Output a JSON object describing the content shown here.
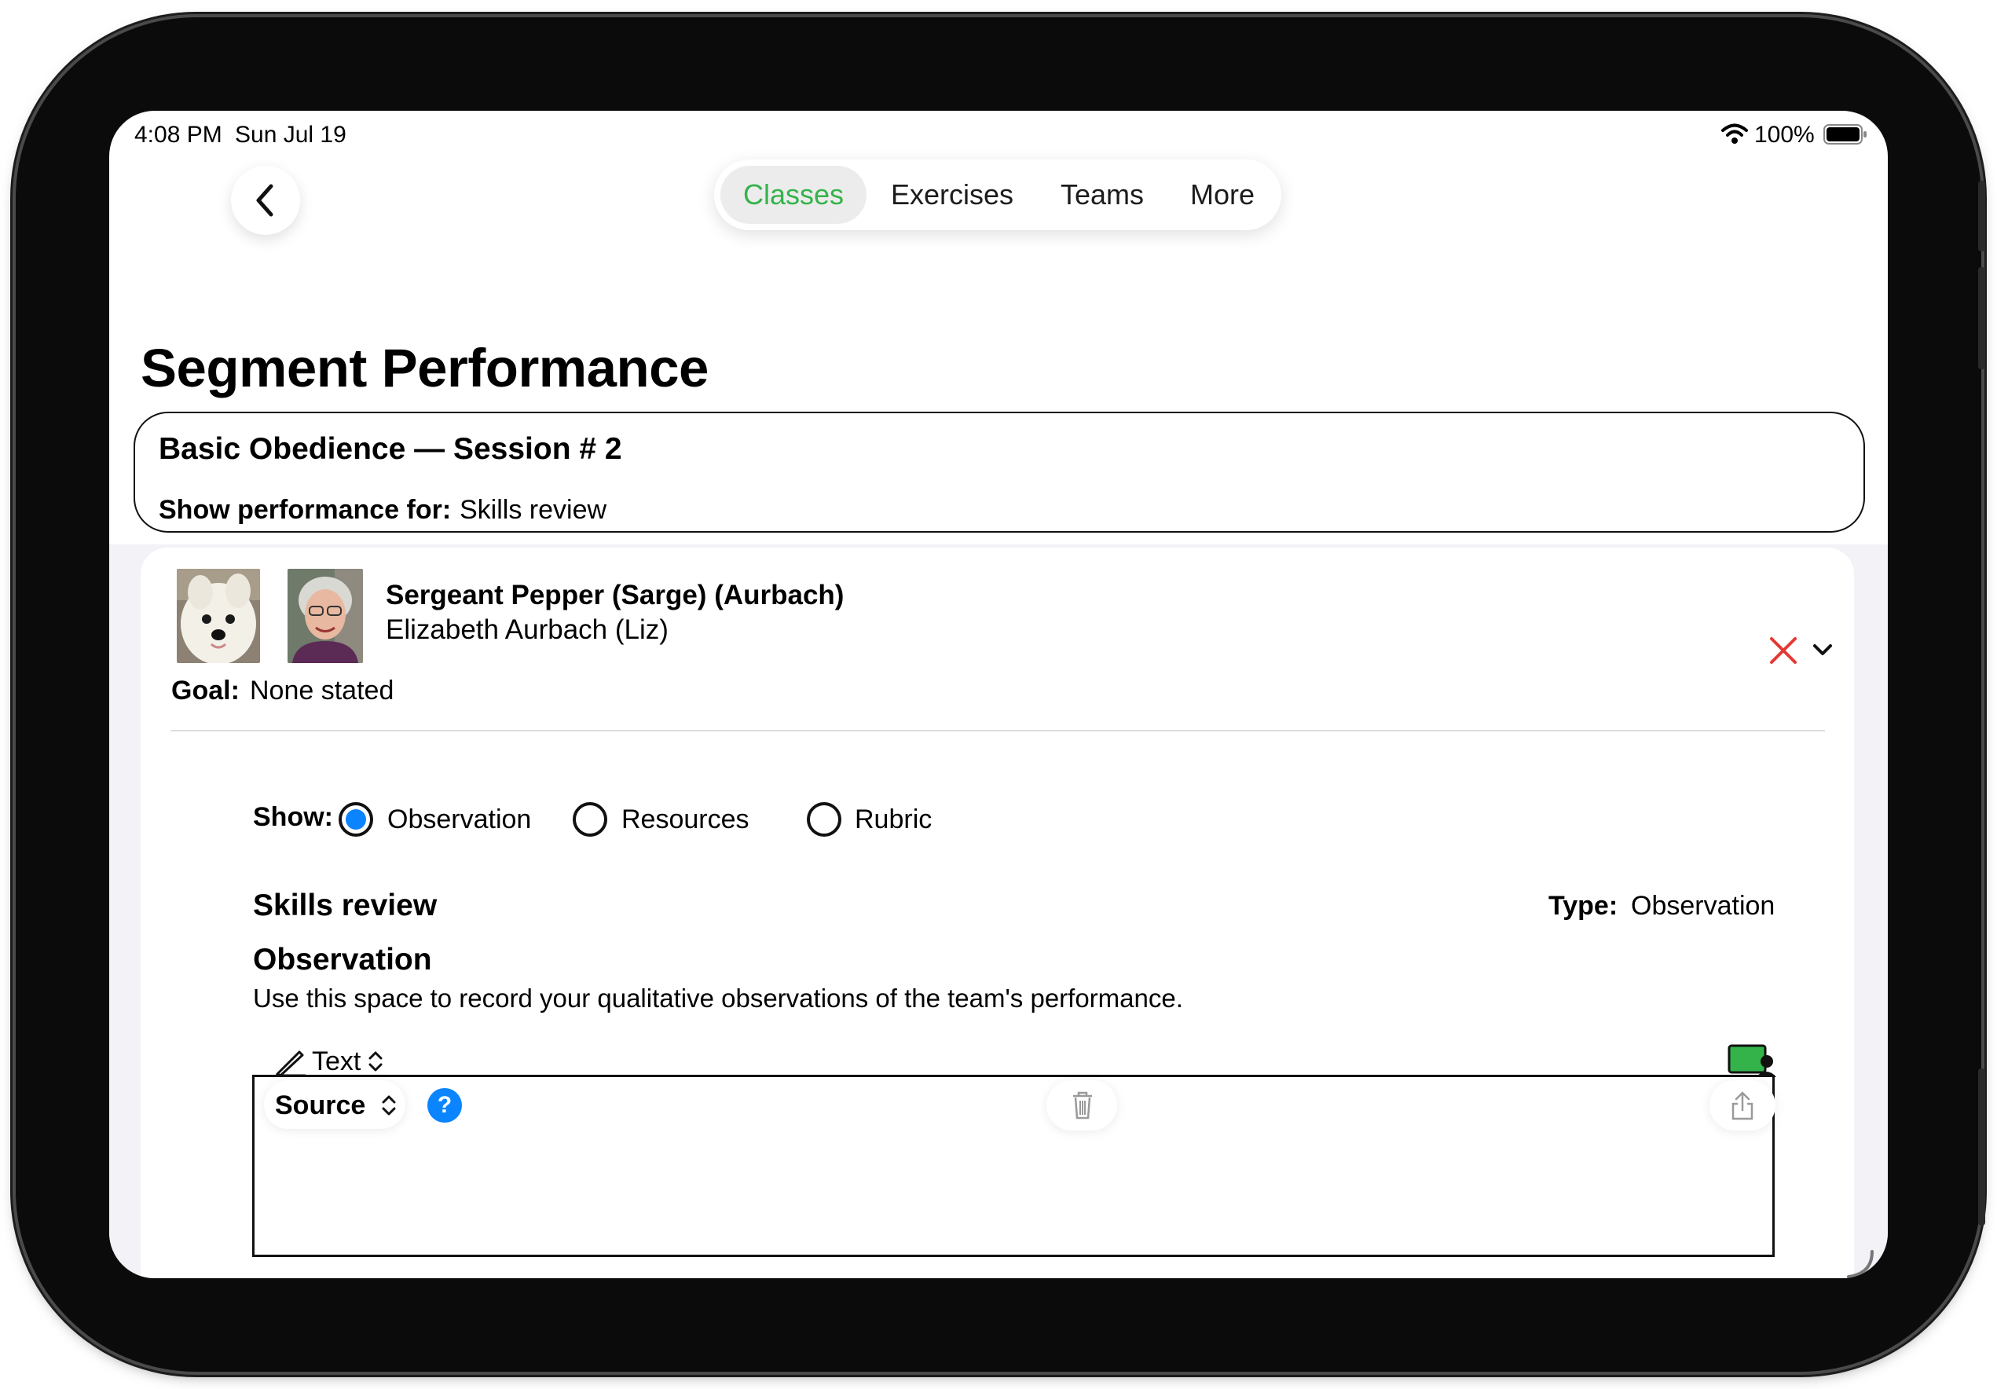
{
  "status_bar": {
    "time": "4:08 PM",
    "date": "Sun Jul 19",
    "battery": "100%"
  },
  "nav": {
    "tabs": [
      {
        "label": "Classes",
        "active": true
      },
      {
        "label": "Exercises",
        "active": false
      },
      {
        "label": "Teams",
        "active": false
      },
      {
        "label": "More",
        "active": false
      }
    ],
    "accent_color": "#34b34a"
  },
  "page": {
    "title": "Segment Performance"
  },
  "session": {
    "name": "Basic Obedience — Session # 2",
    "show_label": "Show performance for:",
    "show_value": "Skills review"
  },
  "team": {
    "dog_name": "Sergeant Pepper (Sarge) (Aurbach)",
    "handler_name": "Elizabeth Aurbach  (Liz)",
    "goal_label": "Goal:",
    "goal_value": "None stated"
  },
  "show_options": {
    "label": "Show:",
    "options": [
      {
        "label": "Observation",
        "selected": true
      },
      {
        "label": "Resources",
        "selected": false
      },
      {
        "label": "Rubric",
        "selected": false
      }
    ],
    "selected_color": "#0a84ff"
  },
  "segment": {
    "heading": "Skills review",
    "type_label": "Type:",
    "type_value": "Observation"
  },
  "observation": {
    "heading": "Observation",
    "description": "Use this space to record your qualitative observations of the team's performance.",
    "mode_label": "Text",
    "source_label": "Source",
    "help_label": "?",
    "text": ""
  },
  "icons": {
    "back": "chevron-left-icon",
    "remove": "x-icon",
    "expand": "chevron-down-icon",
    "pencil": "pencil-icon",
    "updown": "chevron-updown-icon",
    "present": "screen-person-icon",
    "help": "question-icon",
    "trash": "trash-icon",
    "share": "share-icon",
    "remove_color": "#e53935"
  }
}
